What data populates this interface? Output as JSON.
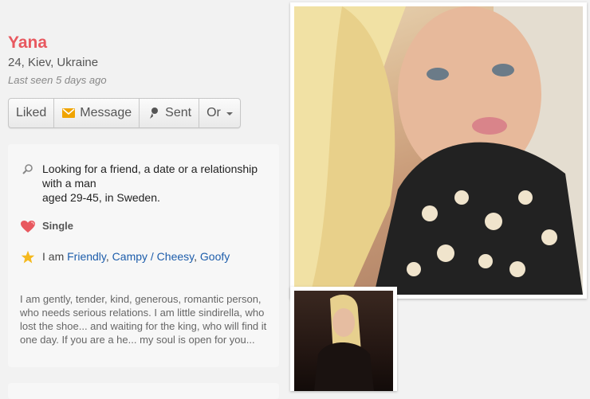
{
  "profile": {
    "name": "Yana",
    "location": "24, Kiev, Ukraine",
    "last_seen": "Last seen 5 days ago"
  },
  "actions": {
    "liked": "Liked",
    "message": "Message",
    "sent": "Sent",
    "or": "Or"
  },
  "details": {
    "looking_line1": "Looking for a friend, a date or a relationship",
    "looking_line2": "with a man",
    "looking_line3": "aged 29-45, in Sweden.",
    "status": "Single",
    "traits_prefix": "I am",
    "traits": [
      "Friendly",
      "Campy / Cheesy",
      "Goofy"
    ],
    "about": "I am gently, tender, kind, generous, romantic person, who needs serious relations. I am little sindirella, who lost the shoe... and waiting for the king, who will find it one day. If you are a he... my soul is open for you..."
  },
  "colors": {
    "name": "#e8585f",
    "link": "#1d5dab",
    "heart": "#e8585f",
    "star": "#f5b91e"
  }
}
